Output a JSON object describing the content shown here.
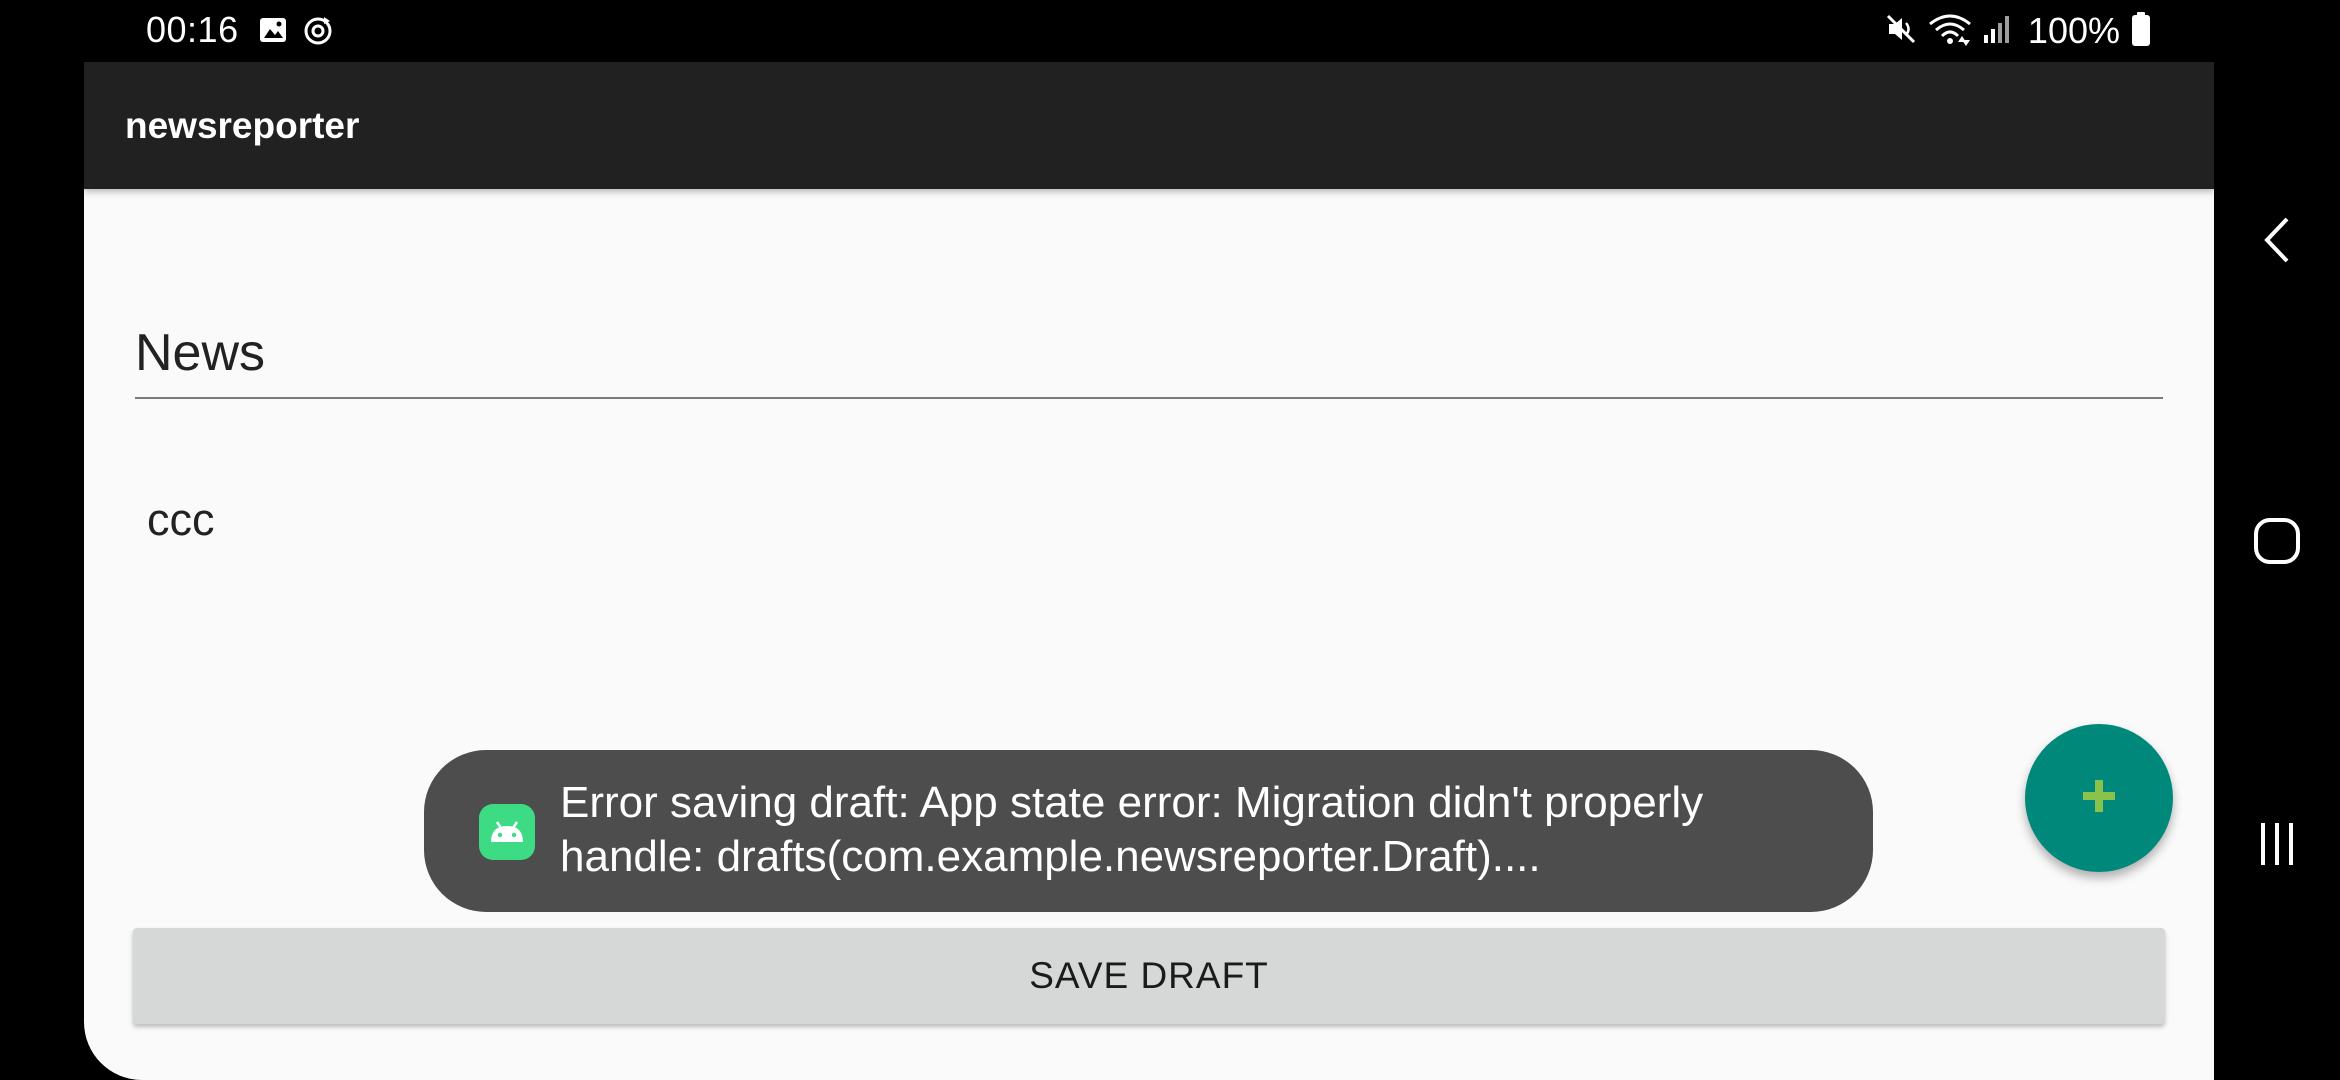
{
  "status_bar": {
    "time": "00:16",
    "battery_percent": "100%",
    "icons": [
      "gallery-icon",
      "sync-icon",
      "mute-icon",
      "wifi-icon",
      "signal-icon",
      "battery-icon"
    ]
  },
  "app_bar": {
    "title": "newsreporter"
  },
  "editor": {
    "title_value": "News",
    "body_value": "ccc"
  },
  "actions": {
    "save_label": "SAVE DRAFT",
    "fab_icon": "plus-icon"
  },
  "toast": {
    "message": "Error saving draft: App state error: Migration didn't properly handle: drafts(com.example.newsreporter.Draft)...."
  },
  "nav_bar": {
    "buttons": [
      "back-icon",
      "home-icon",
      "recents-icon"
    ]
  },
  "colors": {
    "app_bar": "#212121",
    "background": "#fafafa",
    "fab": "#00897b",
    "fab_icon": "#8bc34a",
    "toast": "#4d4d4d",
    "button": "#d6d7d7"
  }
}
